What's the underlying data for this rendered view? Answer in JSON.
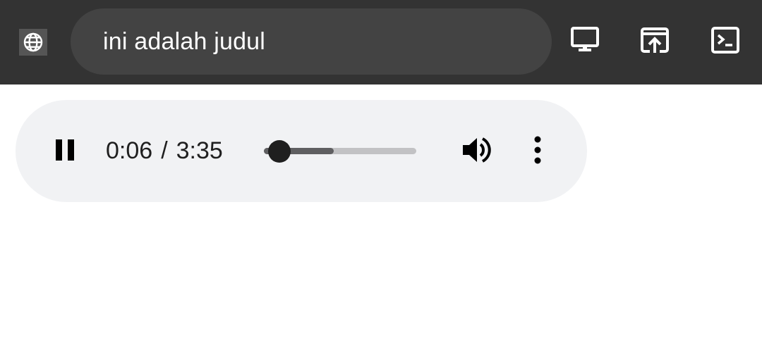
{
  "header": {
    "title": "ini adalah judul",
    "site_icon": "globe-icon",
    "actions": [
      {
        "name": "cast-to-screen",
        "icon": "monitor-icon"
      },
      {
        "name": "open-in-browser",
        "icon": "open-external-icon"
      },
      {
        "name": "console",
        "icon": "terminal-icon"
      }
    ]
  },
  "player": {
    "state_icon": "pause-icon",
    "current_time": "0:06",
    "separator": "/",
    "duration": "3:35",
    "progress_fraction": 0.028,
    "buffered_fraction": 0.46,
    "volume_icon": "volume-icon",
    "menu_icon": "more-vertical-icon"
  },
  "colors": {
    "topbar_bg": "#333333",
    "title_pill_bg": "#434343",
    "player_bg": "#f1f2f4",
    "icon_dark": "#000000",
    "track": "#c2c2c4",
    "buffer": "#5f5f61"
  }
}
